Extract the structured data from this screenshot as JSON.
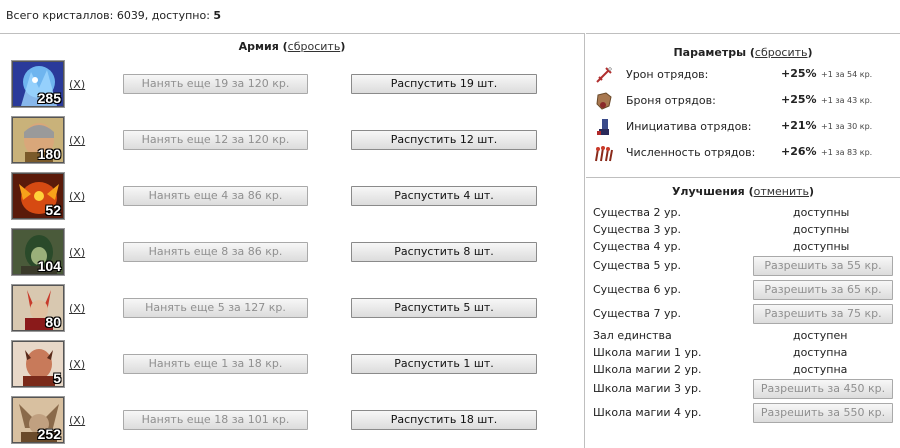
{
  "header": {
    "crystals_prefix": "Всего кристаллов: 6039, доступно: ",
    "available": "5"
  },
  "army": {
    "title": "Армия",
    "reset_open": "(",
    "reset_label": "сбросить",
    "reset_close": ")",
    "remove_label": "(X)",
    "units": [
      {
        "count": "285",
        "hire_label": "Нанять еще 19 за 120 кр.",
        "dismiss_label": "Распустить 19 шт."
      },
      {
        "count": "180",
        "hire_label": "Нанять еще 12 за 120 кр.",
        "dismiss_label": "Распустить 12 шт."
      },
      {
        "count": "52",
        "hire_label": "Нанять еще 4 за 86 кр.",
        "dismiss_label": "Распустить 4 шт."
      },
      {
        "count": "104",
        "hire_label": "Нанять еще 8 за 86 кр.",
        "dismiss_label": "Распустить 8 шт."
      },
      {
        "count": "80",
        "hire_label": "Нанять еще 5 за 127 кр.",
        "dismiss_label": "Распустить 5 шт."
      },
      {
        "count": "5",
        "hire_label": "Нанять еще 1 за 18 кр.",
        "dismiss_label": "Распустить 1 шт."
      },
      {
        "count": "252",
        "hire_label": "Нанять еще 18 за 101 кр.",
        "dismiss_label": "Распустить 18 шт."
      }
    ]
  },
  "params": {
    "title": "Параметры",
    "reset_open": "(",
    "reset_label": "сбросить",
    "reset_close": ")",
    "items": [
      {
        "icon": "sword-icon",
        "label": "Урон отрядов:",
        "value": "+25%",
        "note": "+1 за 54 кр."
      },
      {
        "icon": "shield-icon",
        "label": "Броня отрядов:",
        "value": "+25%",
        "note": "+1 за 43 кр."
      },
      {
        "icon": "boot-icon",
        "label": "Инициатива отрядов:",
        "value": "+21%",
        "note": "+1 за 30 кр."
      },
      {
        "icon": "troops-icon",
        "label": "Численность отрядов:",
        "value": "+26%",
        "note": "+1 за 83 кр."
      }
    ]
  },
  "upgrades": {
    "title": "Улучшения",
    "cancel_open": "(",
    "cancel_label": "отменить",
    "cancel_close": ")",
    "items": [
      {
        "label": "Существа 2 ур.",
        "status": "доступны"
      },
      {
        "label": "Существа 3 ур.",
        "status": "доступны"
      },
      {
        "label": "Существа 4 ур.",
        "status": "доступны"
      },
      {
        "label": "Существа 5 ур.",
        "button": "Разрешить за 55 кр."
      },
      {
        "label": "Существа 6 ур.",
        "button": "Разрешить за 65 кр."
      },
      {
        "label": "Существа 7 ур.",
        "button": "Разрешить за 75 кр."
      },
      {
        "label": "Зал единства",
        "status": "доступен"
      },
      {
        "label": "Школа магии 1 ур.",
        "status": "доступна"
      },
      {
        "label": "Школа магии 2 ур.",
        "status": "доступна"
      },
      {
        "label": "Школа магии 3 ур.",
        "button": "Разрешить за 450 кр."
      },
      {
        "label": "Школа магии 4 ур.",
        "button": "Разрешить за 550 кр."
      }
    ]
  },
  "colors": {
    "border": "#bfbfbf",
    "button_disabled_text": "#8f8f8f"
  }
}
